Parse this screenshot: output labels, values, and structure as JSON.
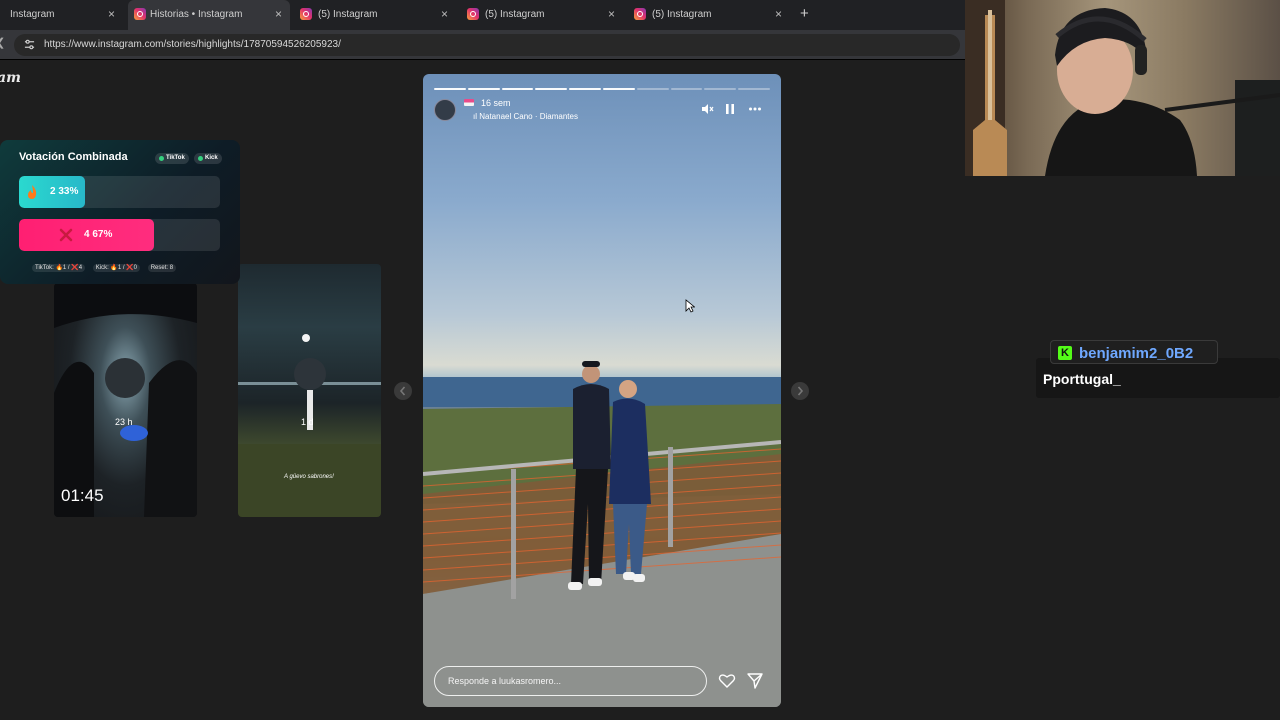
{
  "browser": {
    "tabs": [
      {
        "label": "Instagram",
        "active": false
      },
      {
        "label": "Historias • Instagram",
        "active": true
      },
      {
        "label": "(5) Instagram",
        "active": false
      },
      {
        "label": "(5) Instagram",
        "active": false
      },
      {
        "label": "(5) Instagram",
        "active": false
      }
    ],
    "new_tab": "+",
    "url": "https://www.instagram.com/stories/highlights/17870594526205923/"
  },
  "logo_fragment": "am",
  "vote_widget": {
    "title": "Votación Combinada",
    "chip_tiktok": "TikTok",
    "chip_kick": "Kick",
    "option_a": {
      "text": "2  33%",
      "percent": 33,
      "color": "#2ad9cf"
    },
    "option_b": {
      "text": "4  67%",
      "percent": 67,
      "color": "#ff1f72"
    },
    "footer_tiktok": "TikTok: 🔥1 / ❌4",
    "footer_kick": "Kick: 🔥1 / ❌0",
    "footer_reset": "Reset: 8"
  },
  "thumbs": [
    {
      "age": "23 h",
      "time": "01:45"
    },
    {
      "age": "1 d",
      "caption": "A güevo sabrones!"
    }
  ],
  "story": {
    "progress_total": 10,
    "progress_done": 6,
    "age": "16 sem",
    "music": "Natanael Cano · Diamantes",
    "reply_placeholder": "Responde a luukasromero..."
  },
  "chat": {
    "username": "benjamim2_0B2",
    "message": "Pporttugal_"
  },
  "colors": {
    "kick_green": "#53fc18",
    "username_blue": "#6fa8ff"
  },
  "icons": [
    "instagram-icon",
    "close-icon",
    "tune-icon",
    "mute-icon",
    "pause-icon",
    "more-icon",
    "heart-icon",
    "send-icon",
    "kick-icon",
    "chevron-left-icon",
    "chevron-right-icon"
  ]
}
